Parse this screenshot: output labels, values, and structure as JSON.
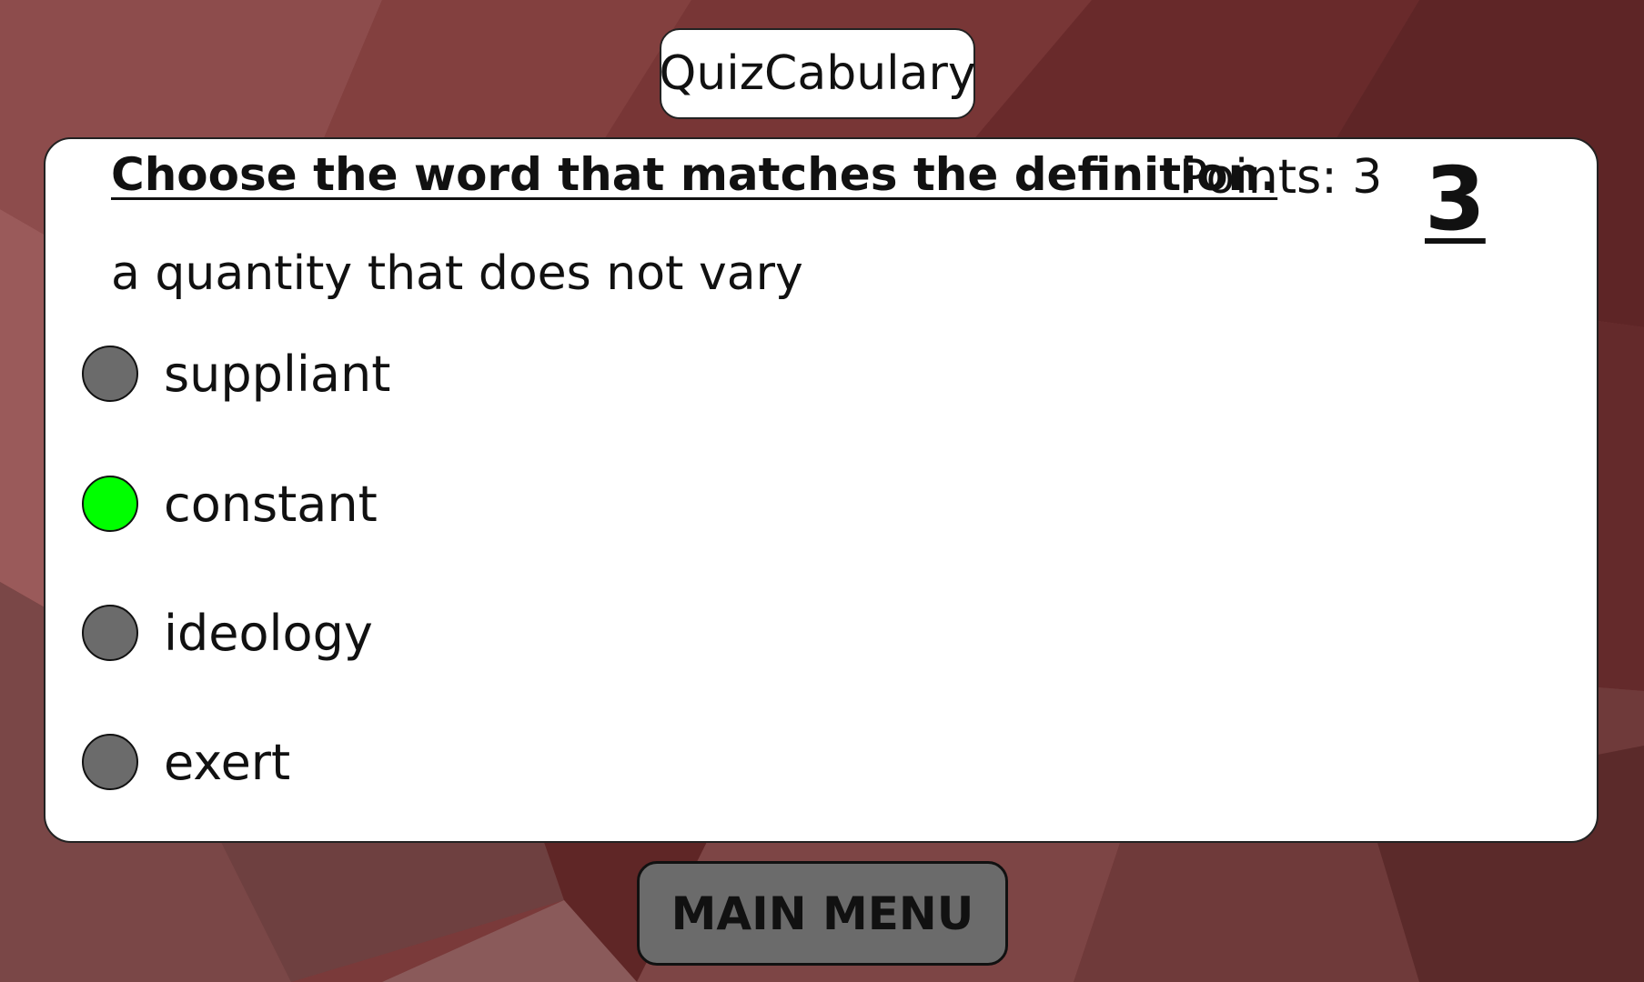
{
  "app": {
    "title": "QuizCabulary"
  },
  "quiz": {
    "instruction": "Choose the word that matches the definition.",
    "points_label": "Points: 3",
    "timer": "3",
    "definition": "a quantity that does not vary",
    "options": [
      {
        "label": "suppliant",
        "state": "unselected",
        "color": "#6b6b6b"
      },
      {
        "label": "constant",
        "state": "selected",
        "color": "#00ff00"
      },
      {
        "label": "ideology",
        "state": "unselected",
        "color": "#6b6b6b"
      },
      {
        "label": "exert",
        "state": "unselected",
        "color": "#6b6b6b"
      }
    ]
  },
  "footer": {
    "main_menu_label": "MAIN MENU"
  },
  "colors": {
    "background": "#7a3a3a",
    "card": "#ffffff",
    "button": "#6b6b6b",
    "selected": "#00ff00"
  }
}
